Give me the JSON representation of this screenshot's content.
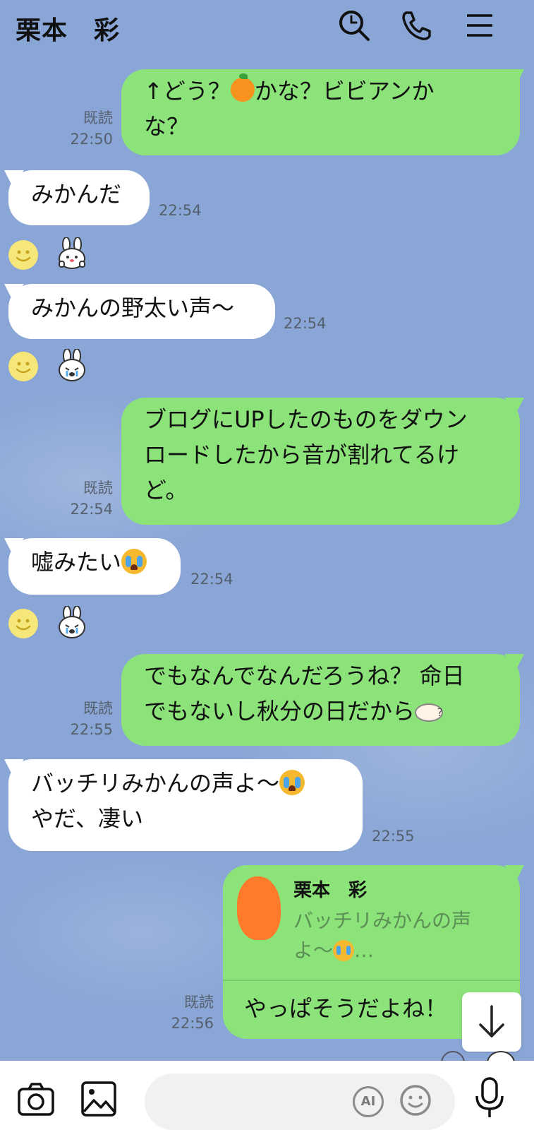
{
  "header": {
    "title": "栗本　彩",
    "icons": [
      "search-icon",
      "phone-icon",
      "menu-icon"
    ]
  },
  "messages": [
    {
      "side": "out",
      "text_line1": "↑どう？",
      "text_line1_after_emoji": "かな？ビビアンか",
      "text_line2": "な？",
      "emoji": "tangerine",
      "read": "既読",
      "time": "22:50"
    },
    {
      "side": "in",
      "text": "みかんだ",
      "time": "22:54"
    },
    {
      "side": "in",
      "text": "みかんの野太い声〜",
      "time": "22:54"
    },
    {
      "side": "out",
      "lines": [
        "ブログにUPしたのものをダウン",
        "ロードしたから音が割れてるけ",
        "ど。"
      ],
      "read": "既読",
      "time": "22:54"
    },
    {
      "side": "in",
      "text": "嘘みたい",
      "emoji": "crying-face",
      "time": "22:54"
    },
    {
      "side": "out",
      "lines": [
        "でもなんでなんだろうね？ 命日",
        "でもないし秋分の日だから"
      ],
      "emoji": "confused-face",
      "read": "既読",
      "time": "22:55"
    },
    {
      "side": "in",
      "lines": [
        "バッチリみかんの声よ〜",
        "やだ、凄い"
      ],
      "emoji": "crying-face",
      "time": "22:55"
    },
    {
      "side": "out",
      "reply_to_name": "栗本　彩",
      "reply_to_line1": "バッチリみかんの声",
      "reply_to_line2": "よ〜",
      "reply_ellipsis": "…",
      "text": "やっぱそうだよね！",
      "read": "既読",
      "time": "22:56"
    }
  ],
  "bottom_bar": {
    "ai_label": "AI",
    "icons": [
      "camera-icon",
      "image-icon",
      "emoji-icon",
      "mic-icon"
    ]
  }
}
